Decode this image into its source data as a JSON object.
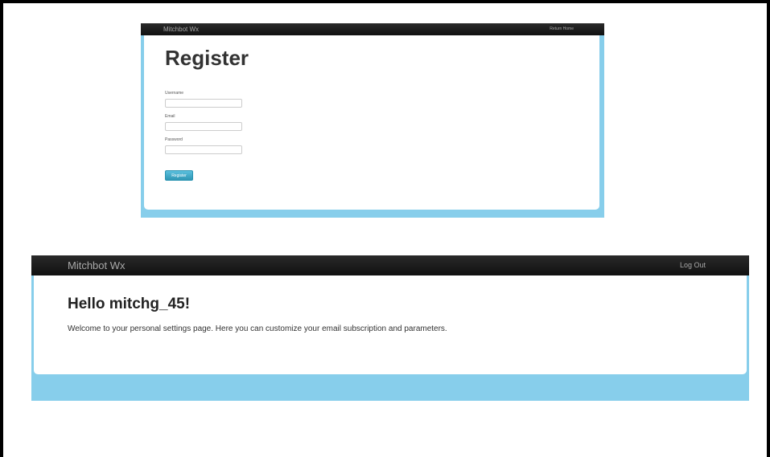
{
  "register_screen": {
    "navbar": {
      "brand": "Mitchbot Wx",
      "link": "Return Home"
    },
    "title": "Register",
    "fields": [
      {
        "label": "Username",
        "value": ""
      },
      {
        "label": "Email",
        "value": ""
      },
      {
        "label": "Password",
        "value": ""
      }
    ],
    "submit_label": "Register"
  },
  "settings_screen": {
    "navbar": {
      "brand": "Mitchbot Wx",
      "link": "Log Out"
    },
    "greeting": "Hello mitchg_45!",
    "message": "Welcome to your personal settings page. Here you can customize your email subscription and parameters."
  },
  "colors": {
    "navbar": "#1b1b1b",
    "page_background": "#87ceeb",
    "register_button": "#49afcd"
  }
}
